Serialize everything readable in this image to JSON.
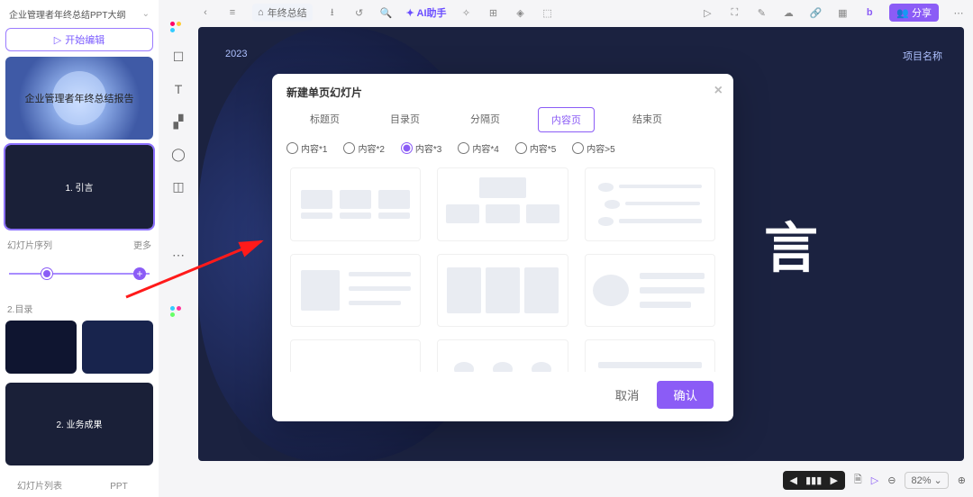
{
  "left": {
    "doc_title": "企业管理者年终总结PPT大纲",
    "start_btn": "开始编辑",
    "slide1_title": "企业管理者年终总结报告",
    "slide2_title": "1. 引言",
    "section_label": "幻灯片序列",
    "section_more": "更多",
    "mini_label": "2.目录",
    "slide4_title": "2. 业务成果",
    "bottom_tab_left": "幻灯片列表",
    "bottom_tab_right": "PPT"
  },
  "topbar": {
    "breadcrumb": "年终总结",
    "ai_label": "AI助手",
    "share": "分享"
  },
  "canvas": {
    "year": "2023",
    "project_label": "项目名称",
    "big_char": "言"
  },
  "status": {
    "zoom": "82%"
  },
  "modal": {
    "title": "新建单页幻灯片",
    "tabs": [
      "标题页",
      "目录页",
      "分隔页",
      "内容页",
      "结束页"
    ],
    "active_tab": 3,
    "radios": [
      "内容*1",
      "内容*2",
      "内容*3",
      "内容*4",
      "内容*5",
      "内容>5"
    ],
    "active_radio": 2,
    "cancel": "取消",
    "confirm": "确认"
  }
}
